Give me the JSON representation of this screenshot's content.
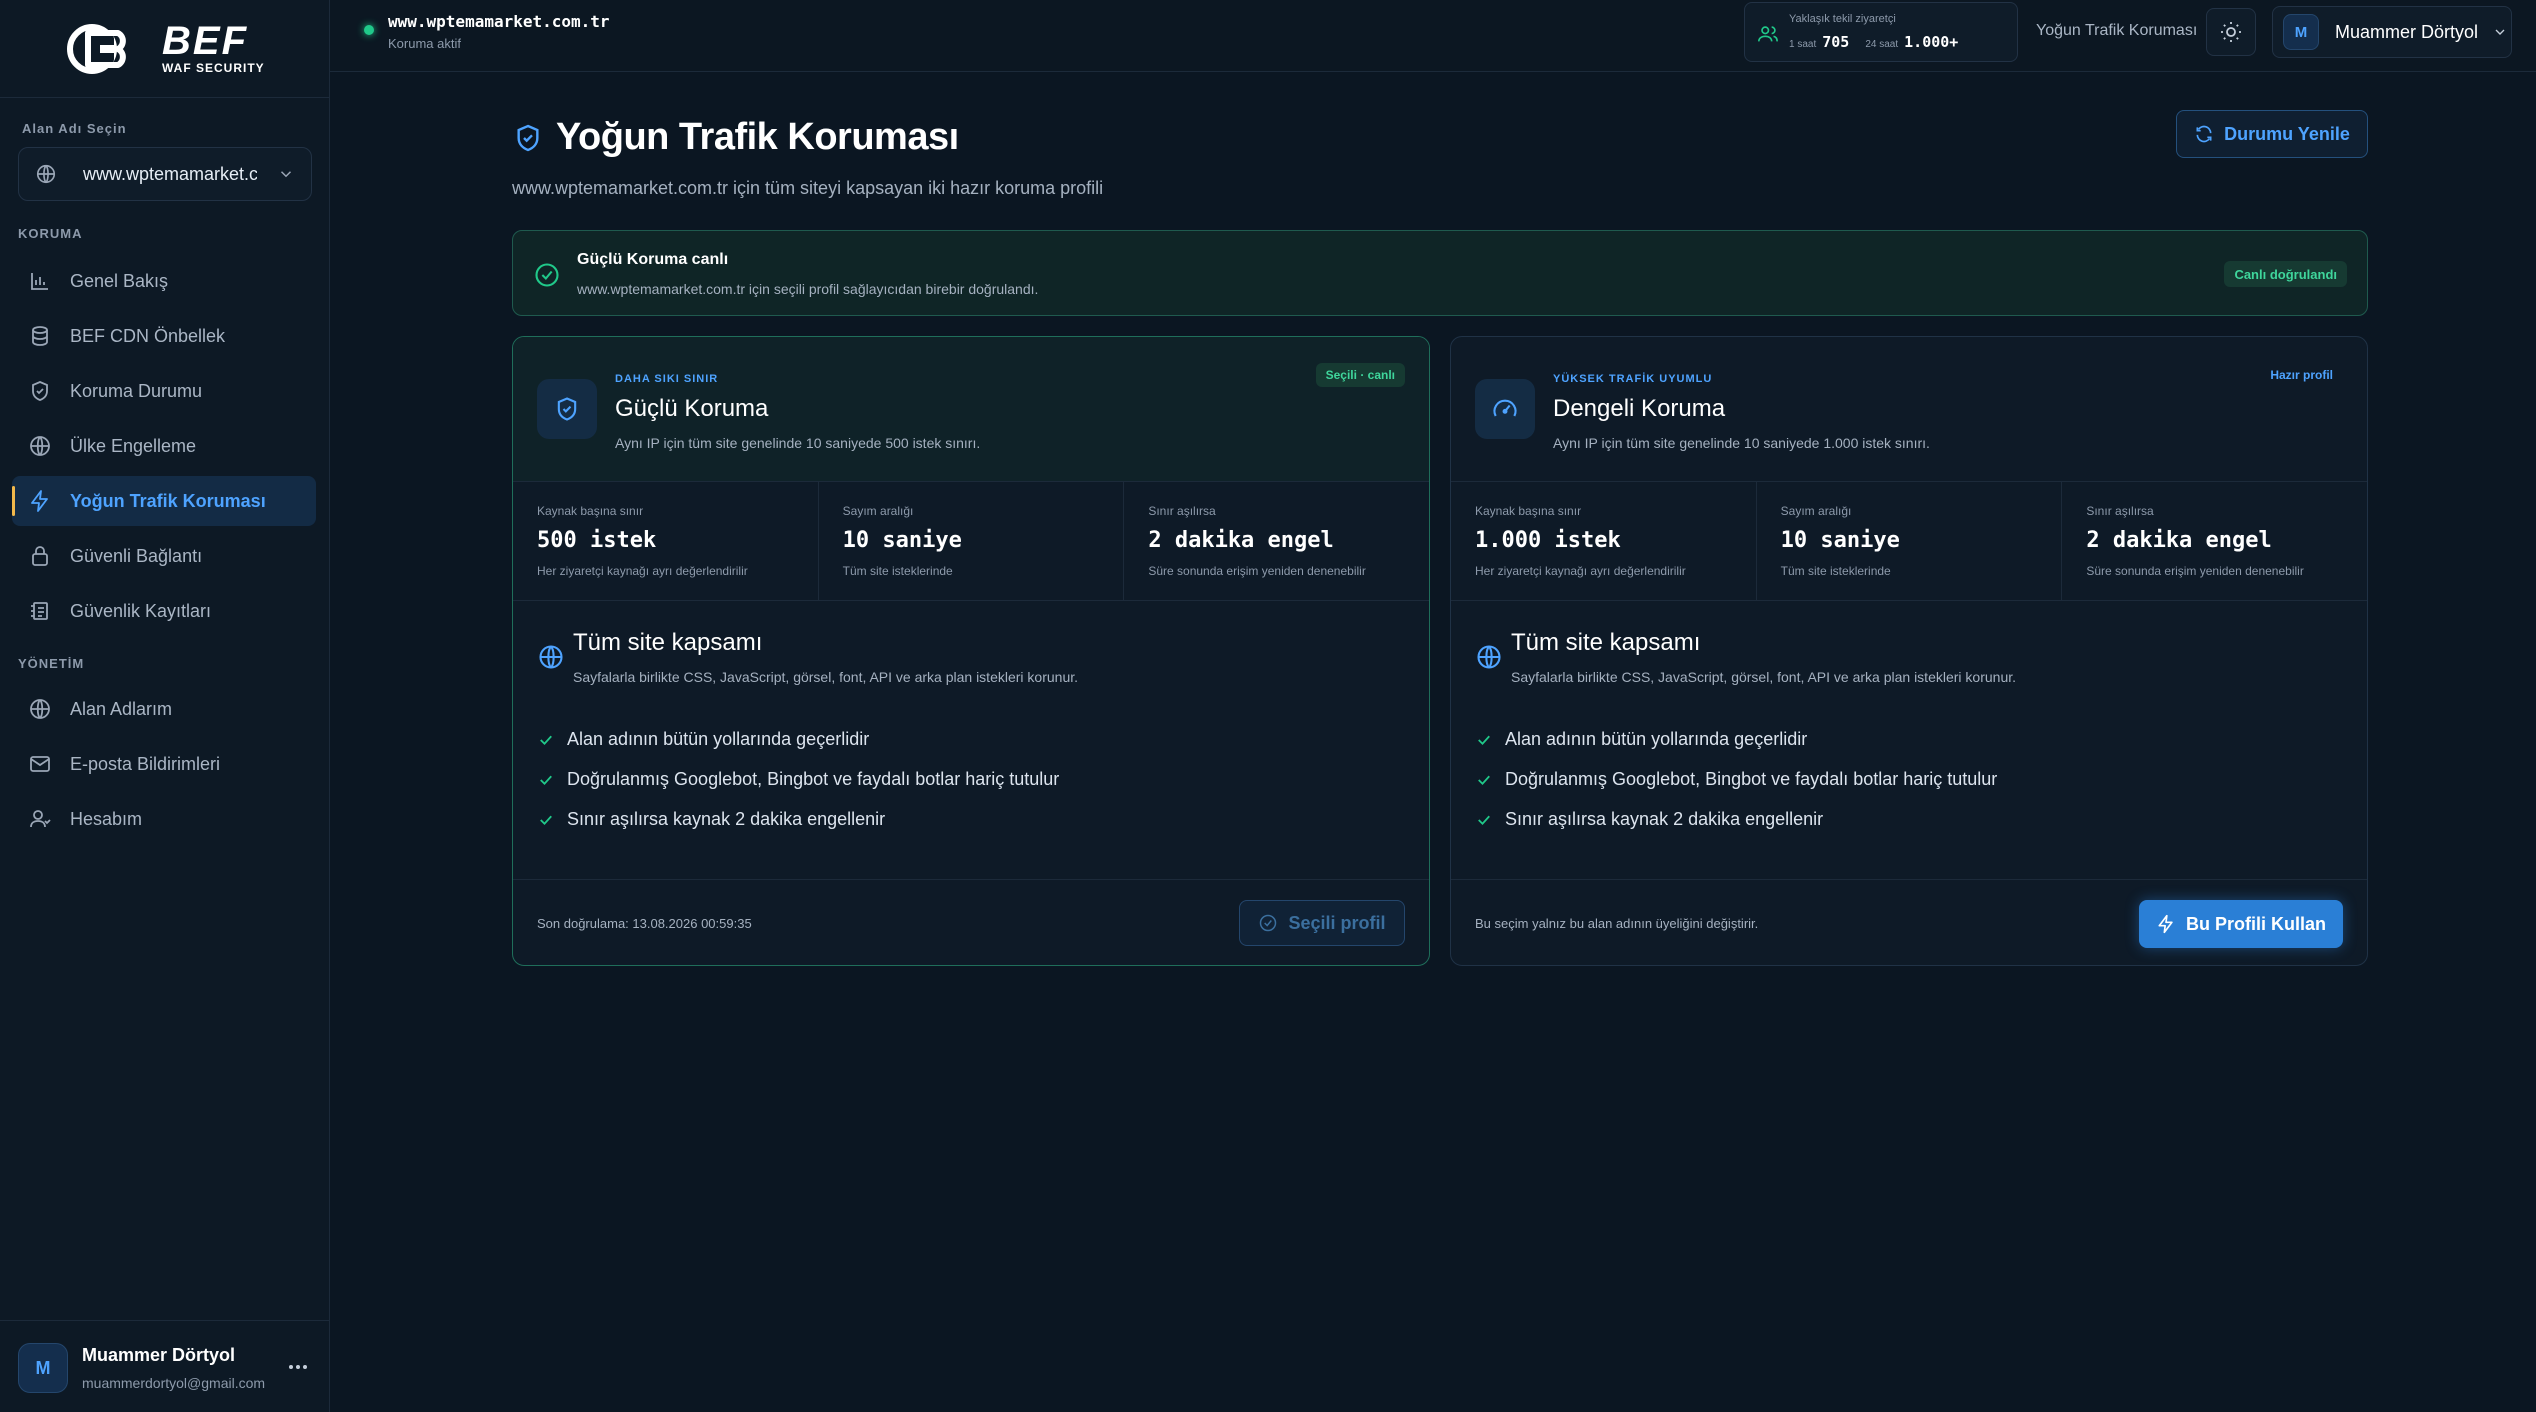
{
  "brand": {
    "name": "BEF",
    "subtitle": "WAF SECURITY"
  },
  "sidebar": {
    "domain_label": "Alan Adı Seçin",
    "domain_value": "www.wptemamarket.com.tr",
    "sections": [
      {
        "title": "KORUMA",
        "items": [
          {
            "label": "Genel Bakış",
            "icon": "bar-chart-icon",
            "active": false
          },
          {
            "label": "BEF CDN Önbellek",
            "icon": "database-icon",
            "active": false
          },
          {
            "label": "Koruma Durumu",
            "icon": "shield-check-icon",
            "active": false
          },
          {
            "label": "Ülke Engelleme",
            "icon": "globe-icon",
            "active": false
          },
          {
            "label": "Yoğun Trafik Koruması",
            "icon": "bolt-icon",
            "active": true
          },
          {
            "label": "Güvenli Bağlantı",
            "icon": "lock-icon",
            "active": false
          },
          {
            "label": "Güvenlik Kayıtları",
            "icon": "log-icon",
            "active": false
          }
        ]
      },
      {
        "title": "YÖNETİM",
        "items": [
          {
            "label": "Alan Adlarım",
            "icon": "globe-icon",
            "active": false
          },
          {
            "label": "E-posta Bildirimleri",
            "icon": "mail-icon",
            "active": false
          },
          {
            "label": "Hesabım",
            "icon": "user-icon",
            "active": false
          }
        ]
      }
    ],
    "user": {
      "initial": "M",
      "name": "Muammer Dörtyol",
      "email": "muammerdortyol@gmail.com"
    }
  },
  "topbar": {
    "site_host": "www.wptemamarket.com.tr",
    "site_status": "Koruma aktif",
    "visitors": {
      "title": "Yaklaşık tekil ziyaretçi",
      "h1_label": "1 saat",
      "h1_value": "705",
      "h24_label": "24 saat",
      "h24_value": "1.000+"
    },
    "page_name": "Yoğun Trafik Koruması",
    "user": {
      "initial": "M",
      "name": "Muammer Dörtyol"
    }
  },
  "main": {
    "title": "Yoğun Trafik Koruması",
    "subtitle": "www.wptemamarket.com.tr için tüm siteyi kapsayan iki hazır koruma profili",
    "refresh_label": "Durumu Yenile",
    "banner": {
      "title": "Güçlü Koruma canlı",
      "desc": "www.wptemamarket.com.tr için seçili profil sağlayıcıdan birebir doğrulandı.",
      "badge": "Canlı doğrulandı"
    },
    "cards": [
      {
        "kicker": "DAHA SIKI SINIR",
        "title": "Güçlü Koruma",
        "desc": "Aynı IP için tüm site genelinde 10 saniyede 500 istek sınırı.",
        "badge": "Seçili · canlı",
        "stats": [
          {
            "label": "Kaynak başına sınır",
            "value": "500 istek",
            "desc": "Her ziyaretçi kaynağı ayrı değerlendirilir"
          },
          {
            "label": "Sayım aralığı",
            "value": "10 saniye",
            "desc": "Tüm site isteklerinde"
          },
          {
            "label": "Sınır aşılırsa",
            "value": "2 dakika engel",
            "desc": "Süre sonunda erişim yeniden denenebilir"
          }
        ],
        "coverage_title": "Tüm site kapsamı",
        "coverage_desc": "Sayfalarla birlikte CSS, JavaScript, görsel, font, API ve arka plan istekleri korunur.",
        "features": [
          "Alan adının bütün yollarında geçerlidir",
          "Doğrulanmış Googlebot, Bingbot ve faydalı botlar hariç tutulur",
          "Sınır aşılırsa kaynak 2 dakika engellenir"
        ],
        "foot_note": "Son doğrulama: 13.08.2026 00:59:35",
        "button": "Seçili profil"
      },
      {
        "kicker": "YÜKSEK TRAFİK UYUMLU",
        "title": "Dengeli Koruma",
        "desc": "Aynı IP için tüm site genelinde 10 saniyede 1.000 istek sınırı.",
        "badge": "Hazır profil",
        "stats": [
          {
            "label": "Kaynak başına sınır",
            "value": "1.000 istek",
            "desc": "Her ziyaretçi kaynağı ayrı değerlendirilir"
          },
          {
            "label": "Sayım aralığı",
            "value": "10 saniye",
            "desc": "Tüm site isteklerinde"
          },
          {
            "label": "Sınır aşılırsa",
            "value": "2 dakika engel",
            "desc": "Süre sonunda erişim yeniden denenebilir"
          }
        ],
        "coverage_title": "Tüm site kapsamı",
        "coverage_desc": "Sayfalarla birlikte CSS, JavaScript, görsel, font, API ve arka plan istekleri korunur.",
        "features": [
          "Alan adının bütün yollarında geçerlidir",
          "Doğrulanmış Googlebot, Bingbot ve faydalı botlar hariç tutulur",
          "Sınır aşılırsa kaynak 2 dakika engellenir"
        ],
        "foot_note": "Bu seçim yalnız bu alan adının üyeliğini değiştirir.",
        "button": "Bu Profili Kullan"
      }
    ]
  },
  "colors": {
    "background": "#0b1622",
    "accent": "#4ea3ff",
    "success": "#20c98a",
    "active_marker": "#f2b84b",
    "primary_button": "#2a7fd6"
  }
}
